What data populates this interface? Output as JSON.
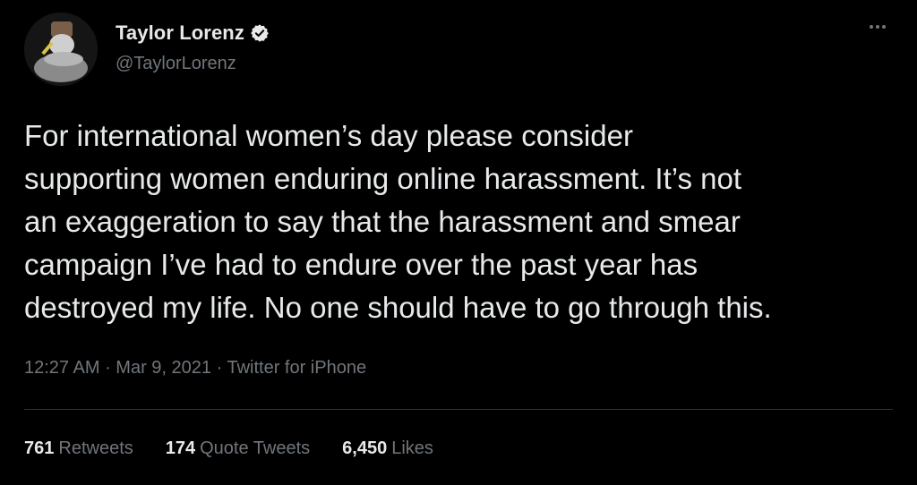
{
  "tweet": {
    "author": {
      "display_name": "Taylor Lorenz",
      "handle": "@TaylorLorenz",
      "verified": true
    },
    "text_lines": [
      "For international women’s day please consider",
      "supporting women enduring online harassment. It’s not",
      "an exaggeration to say that the harassment and smear",
      "campaign I’ve had to endure over the past year has",
      "destroyed my life. No one should have to go through this."
    ],
    "meta": {
      "time": "12:27 AM",
      "separator1": " · ",
      "date": "Mar 9, 2021",
      "separator2": " · ",
      "source": "Twitter for iPhone"
    },
    "stats": {
      "retweets_count": "761",
      "retweets_label": "Retweets",
      "quotes_count": "174",
      "quotes_label": "Quote Tweets",
      "likes_count": "6,450",
      "likes_label": "Likes"
    }
  },
  "colors": {
    "background": "#000000",
    "primary_text": "#e7e9ea",
    "secondary_text": "#71767b",
    "divider": "#2f3336",
    "verified_badge": "#e7e9ea"
  },
  "icons": {
    "verified": "verified-badge-icon",
    "more": "more-horizontal-icon"
  }
}
